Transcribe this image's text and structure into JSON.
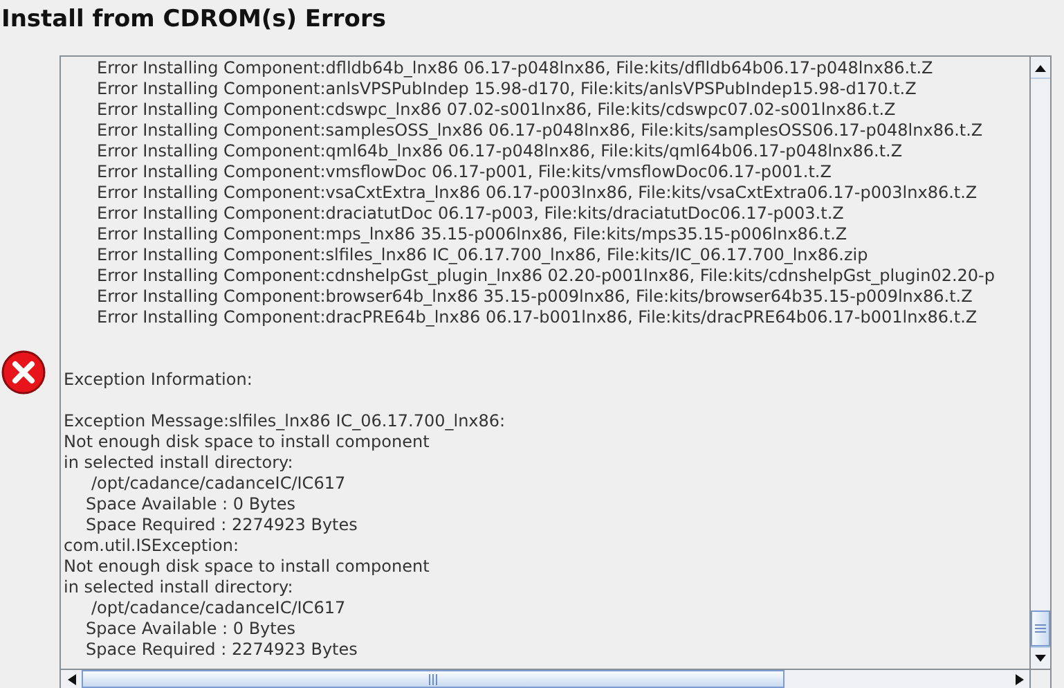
{
  "window": {
    "title": "Install from CDROM(s) Errors"
  },
  "log": [
    {
      "kind": "entry",
      "text": "Error Installing Component:dflldb64b_lnx86 06.17-p048lnx86, File:kits/dflldb64b06.17-p048lnx86.t.Z"
    },
    {
      "kind": "entry",
      "text": "Error Installing Component:anlsVPSPubIndep 15.98-d170, File:kits/anlsVPSPubIndep15.98-d170.t.Z"
    },
    {
      "kind": "entry",
      "text": "Error Installing Component:cdswpc_lnx86 07.02-s001lnx86, File:kits/cdswpc07.02-s001lnx86.t.Z"
    },
    {
      "kind": "entry",
      "text": "Error Installing Component:samplesOSS_lnx86 06.17-p048lnx86, File:kits/samplesOSS06.17-p048lnx86.t.Z"
    },
    {
      "kind": "entry",
      "text": "Error Installing Component:qml64b_lnx86 06.17-p048lnx86, File:kits/qml64b06.17-p048lnx86.t.Z"
    },
    {
      "kind": "entry",
      "text": "Error Installing Component:vmsflowDoc 06.17-p001, File:kits/vmsflowDoc06.17-p001.t.Z"
    },
    {
      "kind": "entry",
      "text": "Error Installing Component:vsaCxtExtra_lnx86 06.17-p003lnx86, File:kits/vsaCxtExtra06.17-p003lnx86.t.Z"
    },
    {
      "kind": "entry",
      "text": "Error Installing Component:draciatutDoc 06.17-p003, File:kits/draciatutDoc06.17-p003.t.Z"
    },
    {
      "kind": "entry",
      "text": "Error Installing Component:mps_lnx86 35.15-p006lnx86, File:kits/mps35.15-p006lnx86.t.Z"
    },
    {
      "kind": "entry",
      "text": "Error Installing Component:slfiles_lnx86 IC_06.17.700_lnx86, File:kits/IC_06.17.700_lnx86.zip"
    },
    {
      "kind": "entry",
      "text": "Error Installing Component:cdnshelpGst_plugin_lnx86 02.20-p001lnx86, File:kits/cdnshelpGst_plugin02.20-p"
    },
    {
      "kind": "entry",
      "text": "Error Installing Component:browser64b_lnx86 35.15-p009lnx86, File:kits/browser64b35.15-p009lnx86.t.Z"
    },
    {
      "kind": "entry",
      "text": "Error Installing Component:dracPRE64b_lnx86 06.17-b001lnx86, File:kits/dracPRE64b06.17-b001lnx86.t.Z"
    },
    {
      "kind": "blank"
    },
    {
      "kind": "blank"
    },
    {
      "kind": "plain",
      "text": "Exception Information:"
    },
    {
      "kind": "blank"
    },
    {
      "kind": "plain",
      "text": "Exception Message:slfiles_lnx86 IC_06.17.700_lnx86:"
    },
    {
      "kind": "plain",
      "text": "Not enough disk space to install component"
    },
    {
      "kind": "plain",
      "text": "in selected install directory:"
    },
    {
      "kind": "path",
      "text": "/opt/cadance/cadanceIC/IC617"
    },
    {
      "kind": "detail",
      "text": "Space Available : 0 Bytes"
    },
    {
      "kind": "detail",
      "text": "Space Required : 2274923 Bytes"
    },
    {
      "kind": "plain",
      "text": "com.util.ISException:"
    },
    {
      "kind": "plain",
      "text": "Not enough disk space to install component"
    },
    {
      "kind": "plain",
      "text": "in selected install directory:"
    },
    {
      "kind": "path",
      "text": "/opt/cadance/cadanceIC/IC617"
    },
    {
      "kind": "detail",
      "text": "Space Available : 0 Bytes"
    },
    {
      "kind": "detail",
      "text": "Space Required : 2274923 Bytes"
    }
  ]
}
